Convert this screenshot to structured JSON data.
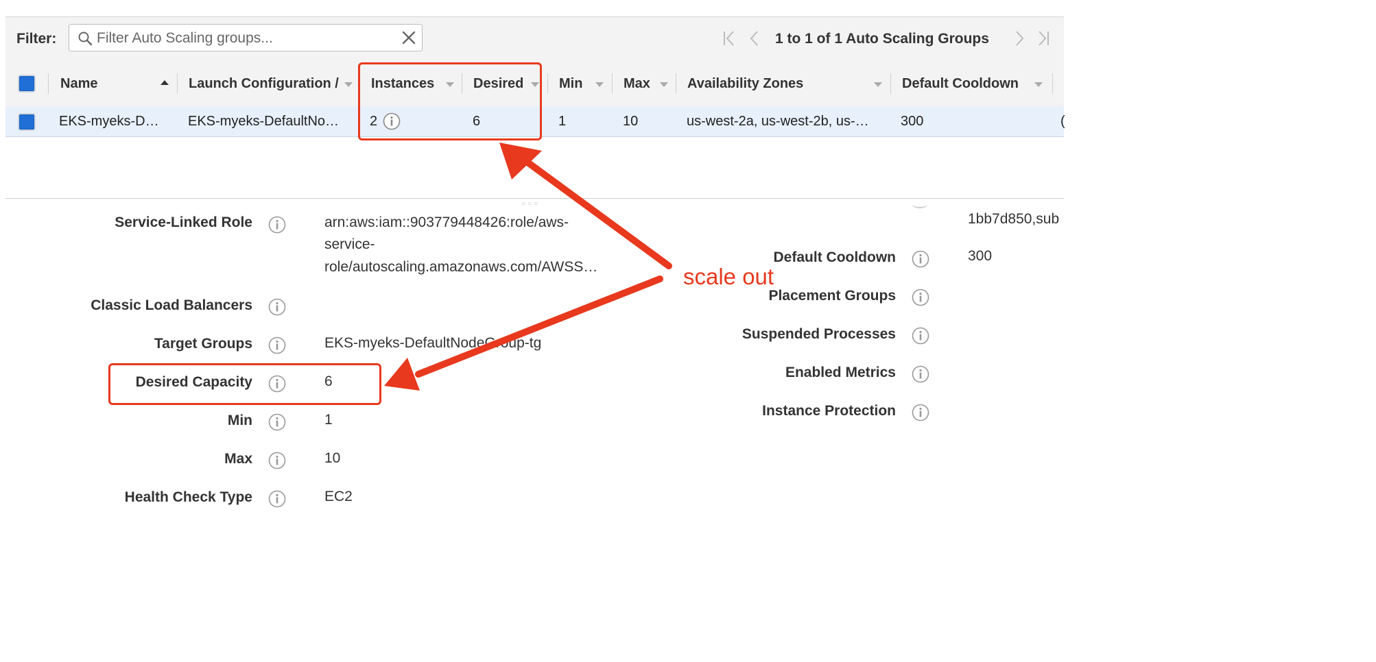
{
  "filter": {
    "label": "Filter:",
    "placeholder": "Filter Auto Scaling groups..."
  },
  "pager": {
    "text": "1 to 1 of 1 Auto Scaling Groups"
  },
  "table": {
    "headers": {
      "name": "Name",
      "launch": "Launch Configuration /",
      "instances": "Instances",
      "desired": "Desired",
      "min": "Min",
      "max": "Max",
      "zones": "Availability Zones",
      "cooldown": "Default Cooldown"
    },
    "row": {
      "name": "EKS-myeks-D…",
      "launch": "EKS-myeks-DefaultNo…",
      "instances": "2",
      "desired": "6",
      "min": "1",
      "max": "10",
      "zones": "us-west-2a, us-west-2b, us-…",
      "cooldown": "300",
      "overflow": "("
    }
  },
  "details": {
    "left": [
      {
        "label": "Service-Linked Role",
        "value_lines": [
          "arn:aws:iam::903779448426:role/aws-",
          "service-",
          "role/autoscaling.amazonaws.com/AWSS…"
        ]
      },
      {
        "label": "Classic Load Balancers",
        "value": ""
      },
      {
        "label": "Target Groups",
        "value": "EKS-myeks-DefaultNodeGroup-tg"
      },
      {
        "label": "Desired Capacity",
        "value": "6"
      },
      {
        "label": "Min",
        "value": "1"
      },
      {
        "label": "Max",
        "value": "10"
      },
      {
        "label": "Health Check Type",
        "value": "EC2"
      }
    ],
    "right_top_value": "1bb7d850,sub",
    "right": [
      {
        "label": "Default Cooldown",
        "value": "300"
      },
      {
        "label": "Placement Groups",
        "value": ""
      },
      {
        "label": "Suspended Processes",
        "value": ""
      },
      {
        "label": "Enabled Metrics",
        "value": ""
      },
      {
        "label": "Instance Protection",
        "value": ""
      }
    ]
  },
  "annotation": {
    "text": "scale out",
    "color": "#e8391e"
  },
  "colors": {
    "checkbox": "#1f6fd6",
    "selected_row": "#e8f0fb",
    "header_bg": "#f3f3f3"
  }
}
